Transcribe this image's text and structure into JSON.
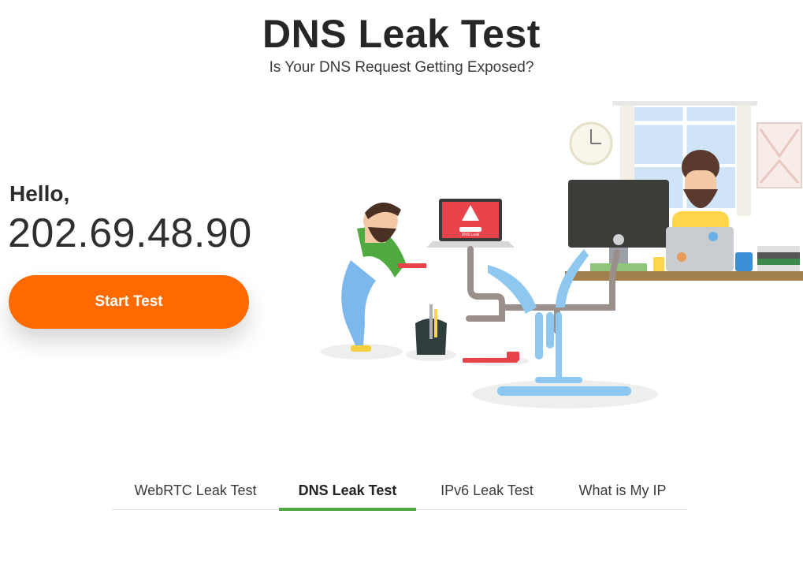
{
  "header": {
    "title": "DNS Leak Test",
    "subtitle": "Is Your DNS Request Getting Exposed?"
  },
  "hero": {
    "greeting": "Hello,",
    "ip_address": "202.69.48.90",
    "start_button_label": "Start Test",
    "accent_color": "#ff6a00"
  },
  "illustration": {
    "laptop_alert_text": "DNS Leak"
  },
  "tabs": [
    {
      "label": "WebRTC Leak Test",
      "active": false
    },
    {
      "label": "DNS Leak Test",
      "active": true
    },
    {
      "label": "IPv6 Leak Test",
      "active": false
    },
    {
      "label": "What is My IP",
      "active": false
    }
  ],
  "active_tab_color": "#4fab3f"
}
